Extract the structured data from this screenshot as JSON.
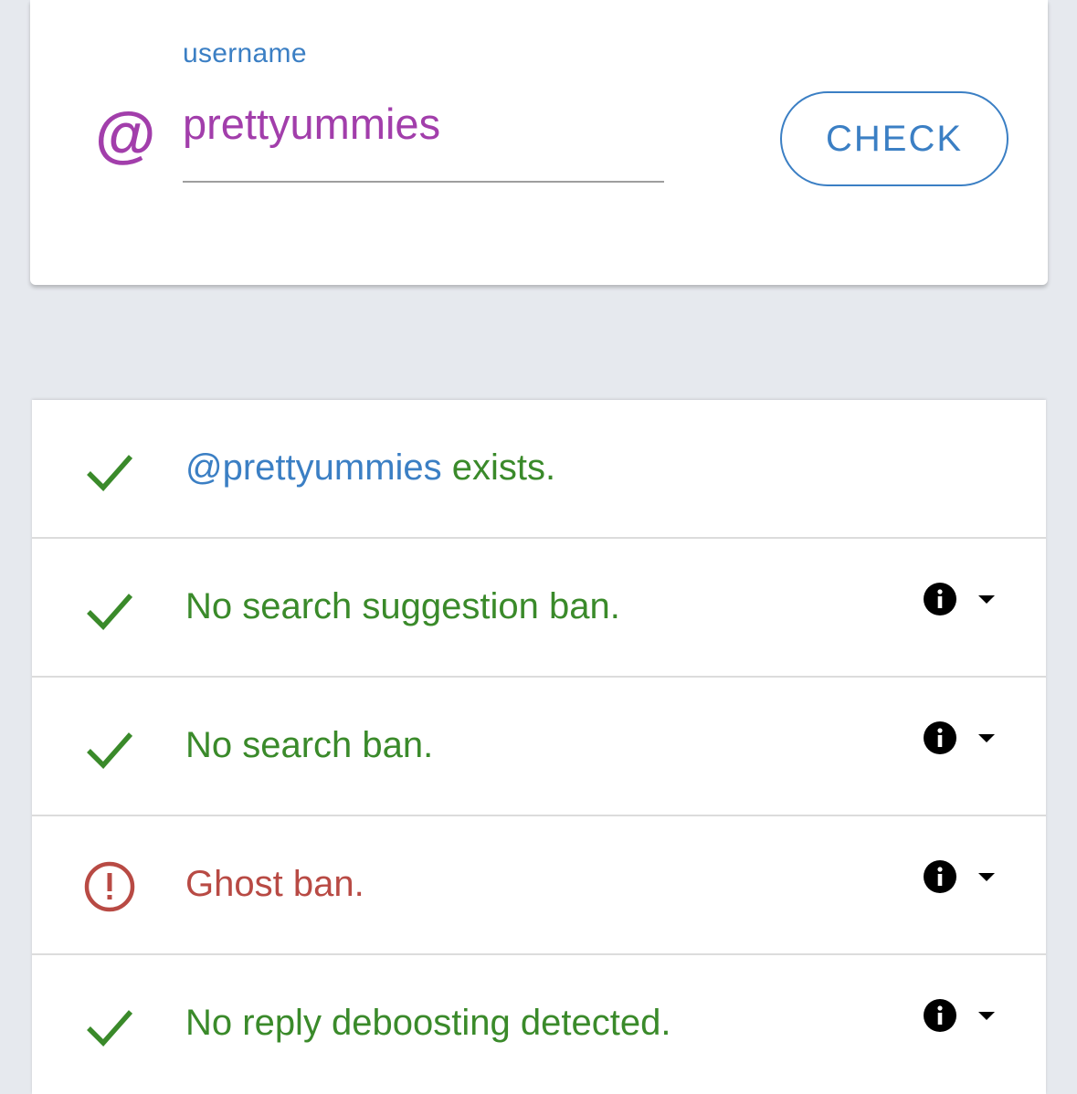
{
  "search": {
    "label": "username",
    "prefix": "@",
    "value": "prettyummies",
    "button_label": "CHECK"
  },
  "results": [
    {
      "status": "ok",
      "handle": "@prettyummies",
      "text": " exists.",
      "has_info": false
    },
    {
      "status": "ok",
      "text": "No search suggestion ban.",
      "has_info": true
    },
    {
      "status": "ok",
      "text": "No search ban.",
      "has_info": true
    },
    {
      "status": "bad",
      "text": "Ghost ban.",
      "has_info": true
    },
    {
      "status": "ok",
      "text": "No reply deboosting detected.",
      "has_info": true
    }
  ],
  "colors": {
    "accent_blue": "#3b7fc4",
    "username_purple": "#a23eab",
    "ok_green": "#3a8a2a",
    "bad_red": "#b84a44",
    "background": "#e6e9ee"
  },
  "icons": {
    "ok": "checkmark-icon",
    "bad": "alert-circle-icon",
    "info": "info-icon",
    "expand": "caret-down-icon"
  }
}
